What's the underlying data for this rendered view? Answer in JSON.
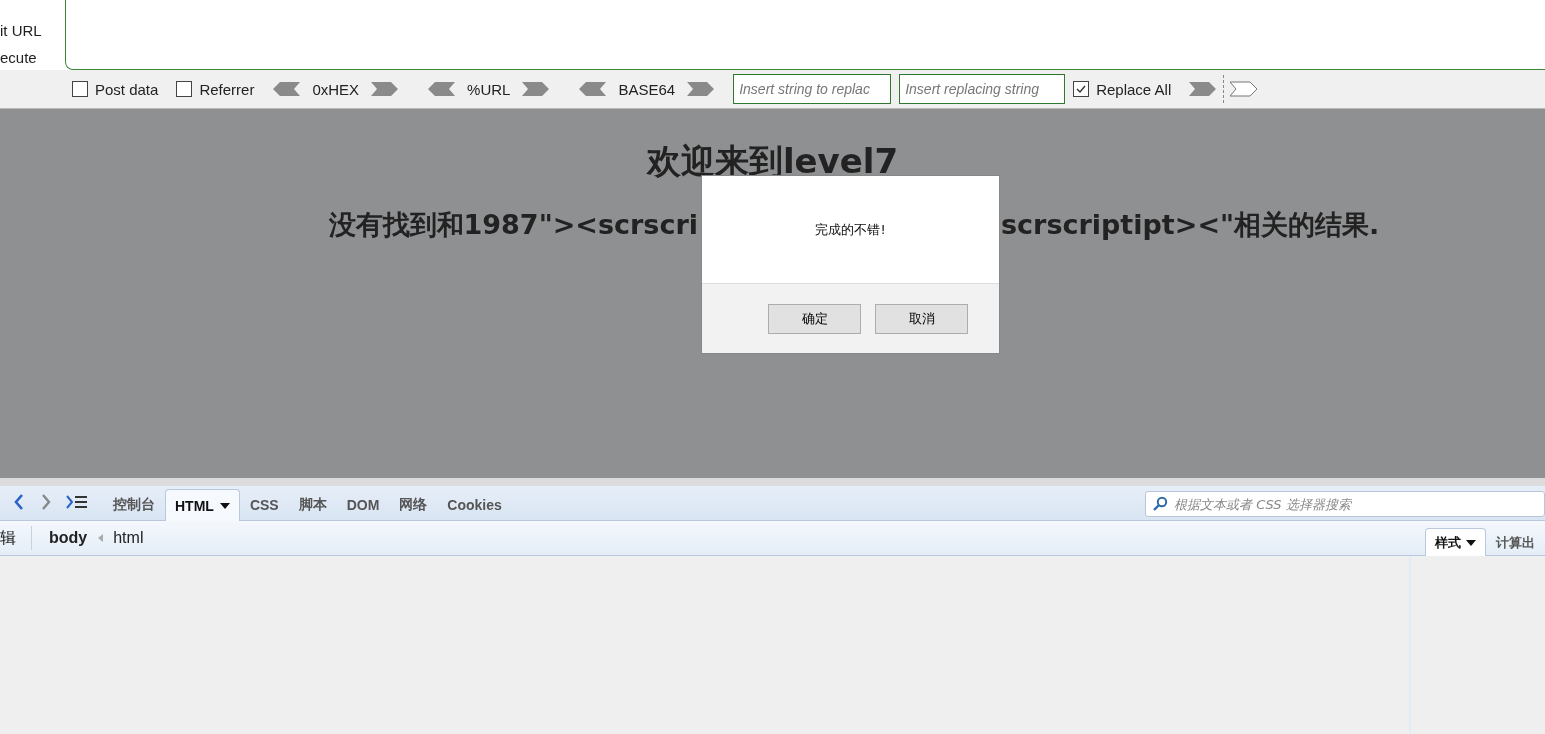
{
  "hackbar": {
    "side_actions": [
      "it URL",
      "ecute"
    ],
    "options": [
      {
        "label": "Post data",
        "checked": false
      },
      {
        "label": "Referrer",
        "checked": false
      }
    ],
    "encoders": [
      "0xHEX",
      "%URL",
      "BASE64"
    ],
    "replace_from": {
      "placeholder": "Insert string to replac"
    },
    "replace_to": {
      "placeholder": "Insert replacing string"
    },
    "replace_all": {
      "label": "Replace All",
      "checked": true
    }
  },
  "page": {
    "heading": "欢迎来到level7",
    "result_left": "没有找到和1987\"><scrscri",
    "result_right": "scrscriptipt><\"相关的结果."
  },
  "dialog": {
    "message": "完成的不错!",
    "buttons": [
      "确定",
      "取消"
    ]
  },
  "devtools": {
    "tabs": [
      {
        "label": "控制台",
        "selected": false,
        "dropdown": false
      },
      {
        "label": "HTML",
        "selected": true,
        "dropdown": true
      },
      {
        "label": "CSS",
        "selected": false,
        "dropdown": false
      },
      {
        "label": "脚本",
        "selected": false,
        "dropdown": false
      },
      {
        "label": "DOM",
        "selected": false,
        "dropdown": false
      },
      {
        "label": "网络",
        "selected": false,
        "dropdown": false
      },
      {
        "label": "Cookies",
        "selected": false,
        "dropdown": false
      }
    ],
    "search": {
      "placeholder": "根据文本或者 CSS 选择器搜索"
    },
    "edit_label": "辑",
    "breadcrumbs": [
      "body",
      "html"
    ],
    "side_tabs": [
      {
        "label": "样式",
        "selected": true,
        "dropdown": true
      },
      {
        "label": "计算出",
        "selected": false,
        "dropdown": false
      }
    ]
  }
}
